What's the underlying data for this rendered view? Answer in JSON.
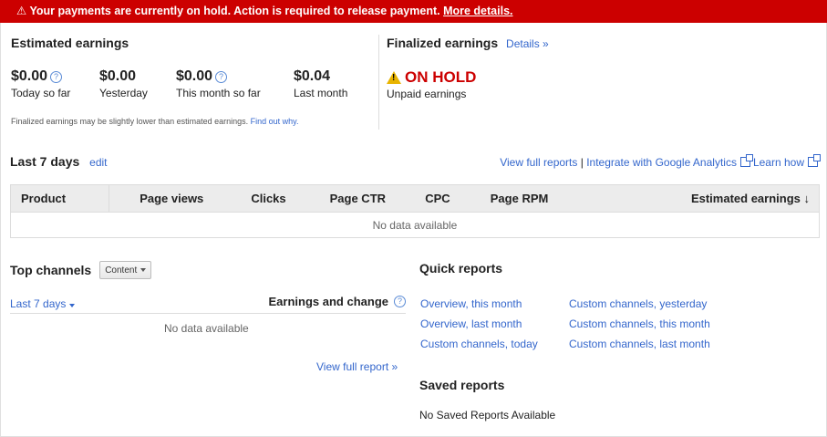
{
  "alert": {
    "icon": "warning-icon",
    "text": "Your payments are currently on hold. Action is required to release payment.",
    "link": "More details.",
    "color": "#cc0000"
  },
  "estimated": {
    "title": "Estimated earnings",
    "items": [
      {
        "amount": "$0.00",
        "label": "Today so far",
        "help": true
      },
      {
        "amount": "$0.00",
        "label": "Yesterday",
        "help": false
      },
      {
        "amount": "$0.00",
        "label": "This month so far",
        "help": true
      },
      {
        "amount": "$0.04",
        "label": "Last month",
        "help": false
      }
    ],
    "note": "Finalized earnings may be slightly lower than estimated earnings.",
    "note_link": "Find out why."
  },
  "finalized": {
    "title": "Finalized earnings",
    "details_link": "Details »",
    "status": "ON HOLD",
    "status_label": "Unpaid earnings"
  },
  "last7": {
    "title": "Last 7 days",
    "edit": "edit",
    "view_full": "View full reports",
    "sep": "|",
    "integrate": "Integrate with Google Analytics",
    "learn_how": "Learn how"
  },
  "table": {
    "columns": [
      "Product",
      "Page views",
      "Clicks",
      "Page CTR",
      "CPC",
      "Page RPM",
      "Estimated earnings ↓"
    ],
    "empty": "No data available"
  },
  "channels": {
    "title": "Top channels",
    "select_value": "Content",
    "range": "Last 7 days",
    "col_header": "Earnings and change",
    "empty": "No data available",
    "view_full": "View full report »"
  },
  "quick_reports": {
    "title": "Quick reports",
    "links": [
      "Overview, this month",
      "Overview, last month",
      "Custom channels, today",
      "Custom channels, yesterday",
      "Custom channels, this month",
      "Custom channels, last month"
    ]
  },
  "saved_reports": {
    "title": "Saved reports",
    "empty": "No Saved Reports Available"
  }
}
